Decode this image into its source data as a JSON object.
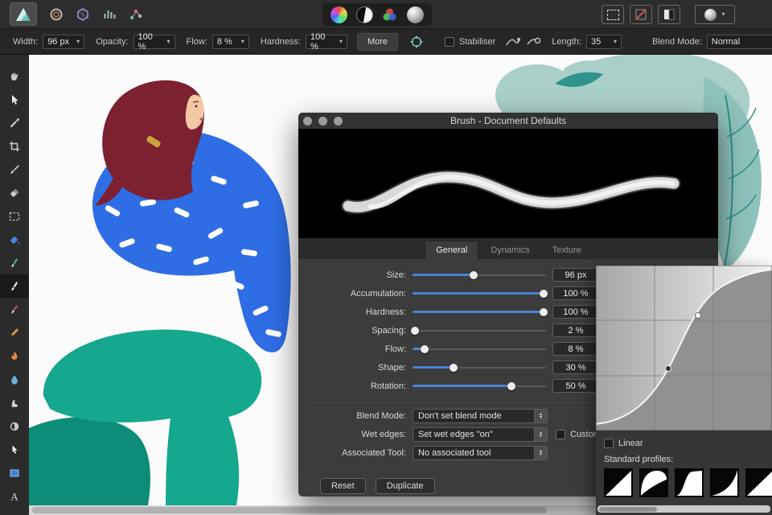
{
  "app_toolbar": {
    "left_icons": [
      "affinity-logo",
      "donut-icon",
      "persona-hexagon-icon",
      "adjust-bars-icon",
      "export-nodes-icon"
    ],
    "center_icons": [
      "color-wheel-icon",
      "mono-circle-icon",
      "rgb-circles-icon",
      "sphere-icon"
    ],
    "right_icons": [
      "marquee-icon",
      "red-slash-icon",
      "gamut-icon",
      "sphere-icon",
      "chevron-down-icon"
    ]
  },
  "context_toolbar": {
    "width_label": "Width:",
    "width_value": "96 px",
    "opacity_label": "Opacity:",
    "opacity_value": "100 %",
    "flow_label": "Flow:",
    "flow_value": "8 %",
    "hardness_label": "Hardness:",
    "hardness_value": "100 %",
    "more_button": "More",
    "stabiliser_label": "Stabiliser",
    "length_label": "Length:",
    "length_value": "35",
    "blend_mode_label": "Blend Mode:",
    "blend_mode_value": "Normal"
  },
  "sidebar_tools": [
    "view-hand-tool",
    "move-tool",
    "colour-picker-tool",
    "crop-tool",
    "vector-brush-tool",
    "eraser-tool",
    "marquee-select-tool",
    "flood-fill-tool",
    "pixel-brush-tool",
    "paint-brush-tool",
    "colour-replacement-brush-tool",
    "pencil-tool",
    "burn-tool",
    "blur-tool",
    "smudge-tool",
    "dodge-tool",
    "node-tool",
    "rectangle-tool",
    "text-tool"
  ],
  "active_tool": "paint-brush-tool",
  "dialog": {
    "title": "Brush - Document Defaults",
    "tabs": [
      "General",
      "Dynamics",
      "Texture"
    ],
    "active_tab": "General",
    "sliders": [
      {
        "label": "Size:",
        "value": "96 px",
        "pct": 46
      },
      {
        "label": "Accumulation:",
        "value": "100 %",
        "pct": 98
      },
      {
        "label": "Hardness:",
        "value": "100 %",
        "pct": 98
      },
      {
        "label": "Spacing:",
        "value": "2 %",
        "pct": 2
      },
      {
        "label": "Flow:",
        "value": "8 %",
        "pct": 9
      },
      {
        "label": "Shape:",
        "value": "30 %",
        "pct": 31
      },
      {
        "label": "Rotation:",
        "value": "50 %",
        "pct": 74
      }
    ],
    "blend_mode_label": "Blend Mode:",
    "blend_mode_value": "Don't set blend mode",
    "wet_edges_label": "Wet edges:",
    "wet_edges_value": "Set wet edges \"on\"",
    "custom_label": "Custom",
    "associated_tool_label": "Associated Tool:",
    "associated_tool_value": "No associated tool",
    "reset_button": "Reset",
    "duplicate_button": "Duplicate"
  },
  "profile_editor": {
    "linear_label": "Linear",
    "standard_profiles_label": "Standard profiles:"
  },
  "colors": {
    "accent_blue": "#4a82d8",
    "pants_teal": "#16a78f",
    "top_blue": "#2f6de5",
    "hair_red": "#7c2130",
    "leaf_teal": "#aacfc9"
  }
}
